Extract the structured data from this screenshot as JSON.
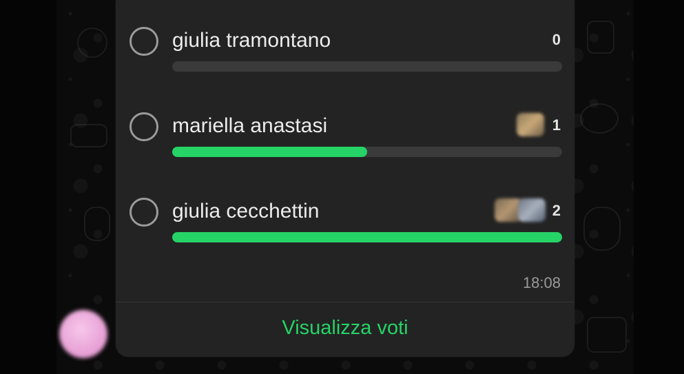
{
  "poll": {
    "options": [
      {
        "label": "giulia tramontano",
        "votes": "0",
        "fraction": 0.0
      },
      {
        "label": "mariella anastasi",
        "votes": "1",
        "fraction": 0.5
      },
      {
        "label": "giulia cecchettin",
        "votes": "2",
        "fraction": 1.0
      }
    ],
    "time": "18:08",
    "view_votes_label": "Visualizza voti"
  },
  "colors": {
    "accent": "#25d366",
    "bubble": "#232323",
    "track": "#3a3a3a",
    "background": "#0b0b0b"
  },
  "icons": {
    "radio": "radio-unselected-icon",
    "avatar": "avatar-icon"
  }
}
